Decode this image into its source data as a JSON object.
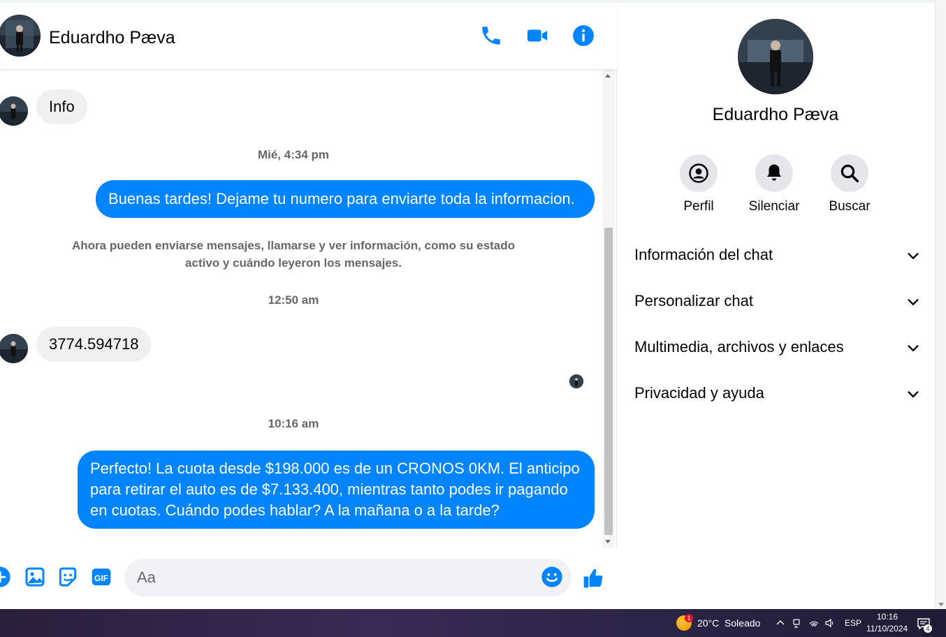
{
  "chat": {
    "contact_name": "Eduardho Pæva",
    "header_icons": [
      "phone-icon",
      "video-camera-icon",
      "info-icon"
    ],
    "messages": {
      "in_1": "Info",
      "ts_1": "Mié, 4:34 pm",
      "out_1": "Buenas tardes! Dejame tu numero para enviarte toda la informacion.",
      "system": "Ahora pueden enviarse mensajes, llamarse y ver información, como su estado activo y cuándo leyeron los mensajes.",
      "ts_2": "12:50 am",
      "in_2": "3774.594718",
      "ts_3": "10:16 am",
      "out_2": "Perfecto! La cuota desde $198.000 es de un CRONOS 0KM. El anticipo para retirar el auto es de $7.133.400, mientras tanto podes ir pagando en cuotas. Cuándo podes hablar? A la mañana o a la tarde?"
    },
    "composer": {
      "placeholder": "Aa",
      "icons": [
        "add-icon",
        "image-icon",
        "sticker-icon",
        "gif-icon",
        "emoji-icon",
        "like-icon"
      ],
      "gif_label": "GIF"
    }
  },
  "info_panel": {
    "name": "Eduardho Pæva",
    "actions": [
      {
        "label": "Perfil",
        "icon": "profile-icon"
      },
      {
        "label": "Silenciar",
        "icon": "bell-icon"
      },
      {
        "label": "Buscar",
        "icon": "search-icon"
      }
    ],
    "sections": [
      "Información del chat",
      "Personalizar chat",
      "Multimedia, archivos y enlaces",
      "Privacidad y ayuda"
    ]
  },
  "taskbar": {
    "weather_badge": "1",
    "weather": "20°C  Soleado",
    "language": "ESP",
    "time": "10:16",
    "date": "11/10/2024",
    "notifications": "4"
  },
  "colors": {
    "accent": "#0084ff",
    "incoming_bubble": "#f0f0f0",
    "secondary_text": "#65676b"
  }
}
